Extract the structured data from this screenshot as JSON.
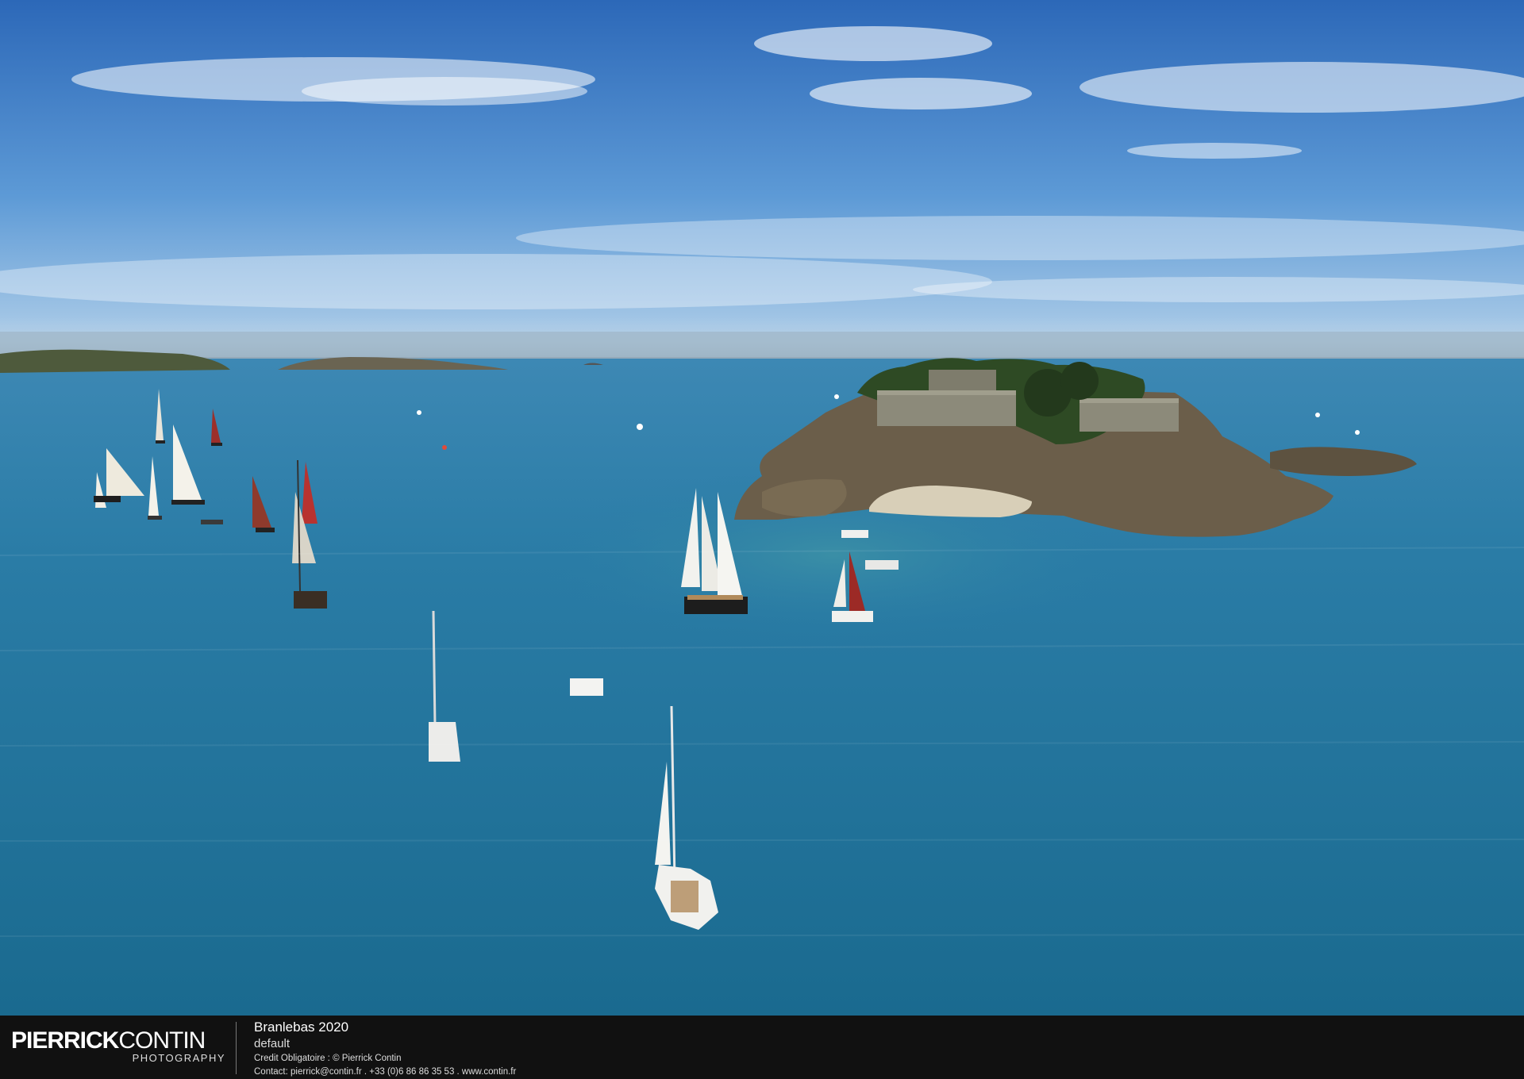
{
  "photo": {
    "subject": "aerial-photo-sailboats-around-fortified-island",
    "colors": {
      "sky_top": "#2f6fbf",
      "sky_horizon": "#a9cbe8",
      "sea_far": "#3a86b0",
      "sea_near": "#1d6f93",
      "rock": "#6b5e4a",
      "vegetation": "#2e4a24",
      "fort_wall": "#8c8a7a",
      "sand": "#d8cfb8"
    }
  },
  "footer": {
    "brand_bold": "PIERRICK",
    "brand_light": "CONTIN",
    "brand_sub": "PHOTOGRAPHY",
    "title": "Branlebas 2020",
    "subtitle": "default",
    "credit": "Credit Obligatoire : © Pierrick Contin",
    "contact": "Contact: pierrick@contin.fr . +33 (0)6 86 86 35 53 . www.contin.fr"
  }
}
